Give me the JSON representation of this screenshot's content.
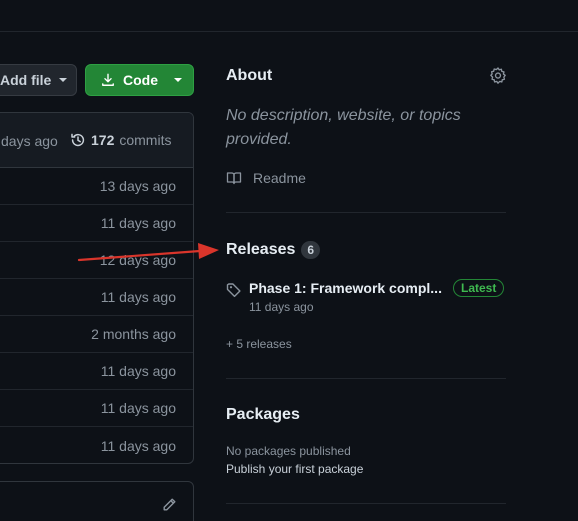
{
  "toolbar": {
    "add_file_label": "Add file",
    "code_label": "Code"
  },
  "file_list": {
    "header_ago": "days ago",
    "commit_count": "172",
    "commits_label": "commits",
    "rows": [
      "13 days ago",
      "11 days ago",
      "12 days ago",
      "11 days ago",
      "2 months ago",
      "11 days ago",
      "11 days ago",
      "11 days ago"
    ]
  },
  "about": {
    "title": "About",
    "description": "No description, website, or topics provided.",
    "readme_label": "Readme"
  },
  "releases": {
    "title": "Releases",
    "count": "6",
    "latest_name": "Phase 1: Framework compl...",
    "latest_badge": "Latest",
    "latest_date": "11 days ago",
    "more_link": "+ 5 releases"
  },
  "packages": {
    "title": "Packages",
    "none_text": "No packages published",
    "publish_link": "Publish your first package"
  },
  "colors": {
    "background": "#0d1117",
    "code_button": "#238636",
    "latest_badge": "#3fb950",
    "annotation_arrow": "#d9352b"
  },
  "icons": [
    "caret-down-icon",
    "download-icon",
    "history-icon",
    "pencil-icon",
    "gear-icon",
    "book-icon",
    "tag-icon"
  ]
}
